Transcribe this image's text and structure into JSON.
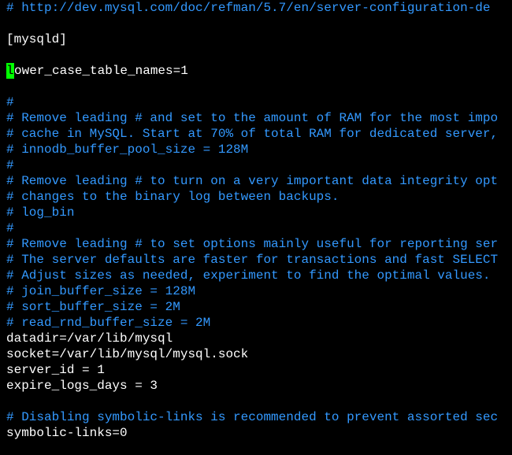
{
  "lines": [
    {
      "type": "comment",
      "text": "# http://dev.mysql.com/doc/refman/5.7/en/server-configuration-de"
    },
    {
      "type": "blank",
      "text": ""
    },
    {
      "type": "white",
      "text": "[mysqld]"
    },
    {
      "type": "blank",
      "text": ""
    },
    {
      "type": "cursor-line",
      "before": "",
      "cursorChar": "l",
      "after": "ower_case_table_names=1"
    },
    {
      "type": "blank",
      "text": ""
    },
    {
      "type": "comment",
      "text": "#"
    },
    {
      "type": "comment",
      "text": "# Remove leading # and set to the amount of RAM for the most impo"
    },
    {
      "type": "comment",
      "text": "# cache in MySQL. Start at 70% of total RAM for dedicated server,"
    },
    {
      "type": "comment",
      "text": "# innodb_buffer_pool_size = 128M"
    },
    {
      "type": "comment",
      "text": "#"
    },
    {
      "type": "comment",
      "text": "# Remove leading # to turn on a very important data integrity opt"
    },
    {
      "type": "comment",
      "text": "# changes to the binary log between backups."
    },
    {
      "type": "comment",
      "text": "# log_bin"
    },
    {
      "type": "comment",
      "text": "#"
    },
    {
      "type": "comment",
      "text": "# Remove leading # to set options mainly useful for reporting ser"
    },
    {
      "type": "comment",
      "text": "# The server defaults are faster for transactions and fast SELECT"
    },
    {
      "type": "comment",
      "text": "# Adjust sizes as needed, experiment to find the optimal values."
    },
    {
      "type": "comment",
      "text": "# join_buffer_size = 128M"
    },
    {
      "type": "comment",
      "text": "# sort_buffer_size = 2M"
    },
    {
      "type": "comment",
      "text": "# read_rnd_buffer_size = 2M"
    },
    {
      "type": "white",
      "text": "datadir=/var/lib/mysql"
    },
    {
      "type": "white",
      "text": "socket=/var/lib/mysql/mysql.sock"
    },
    {
      "type": "white",
      "text": "server_id = 1"
    },
    {
      "type": "white",
      "text": "expire_logs_days = 3"
    },
    {
      "type": "blank",
      "text": ""
    },
    {
      "type": "comment",
      "text": "# Disabling symbolic-links is recommended to prevent assorted sec"
    },
    {
      "type": "white",
      "text": "symbolic-links=0"
    }
  ]
}
